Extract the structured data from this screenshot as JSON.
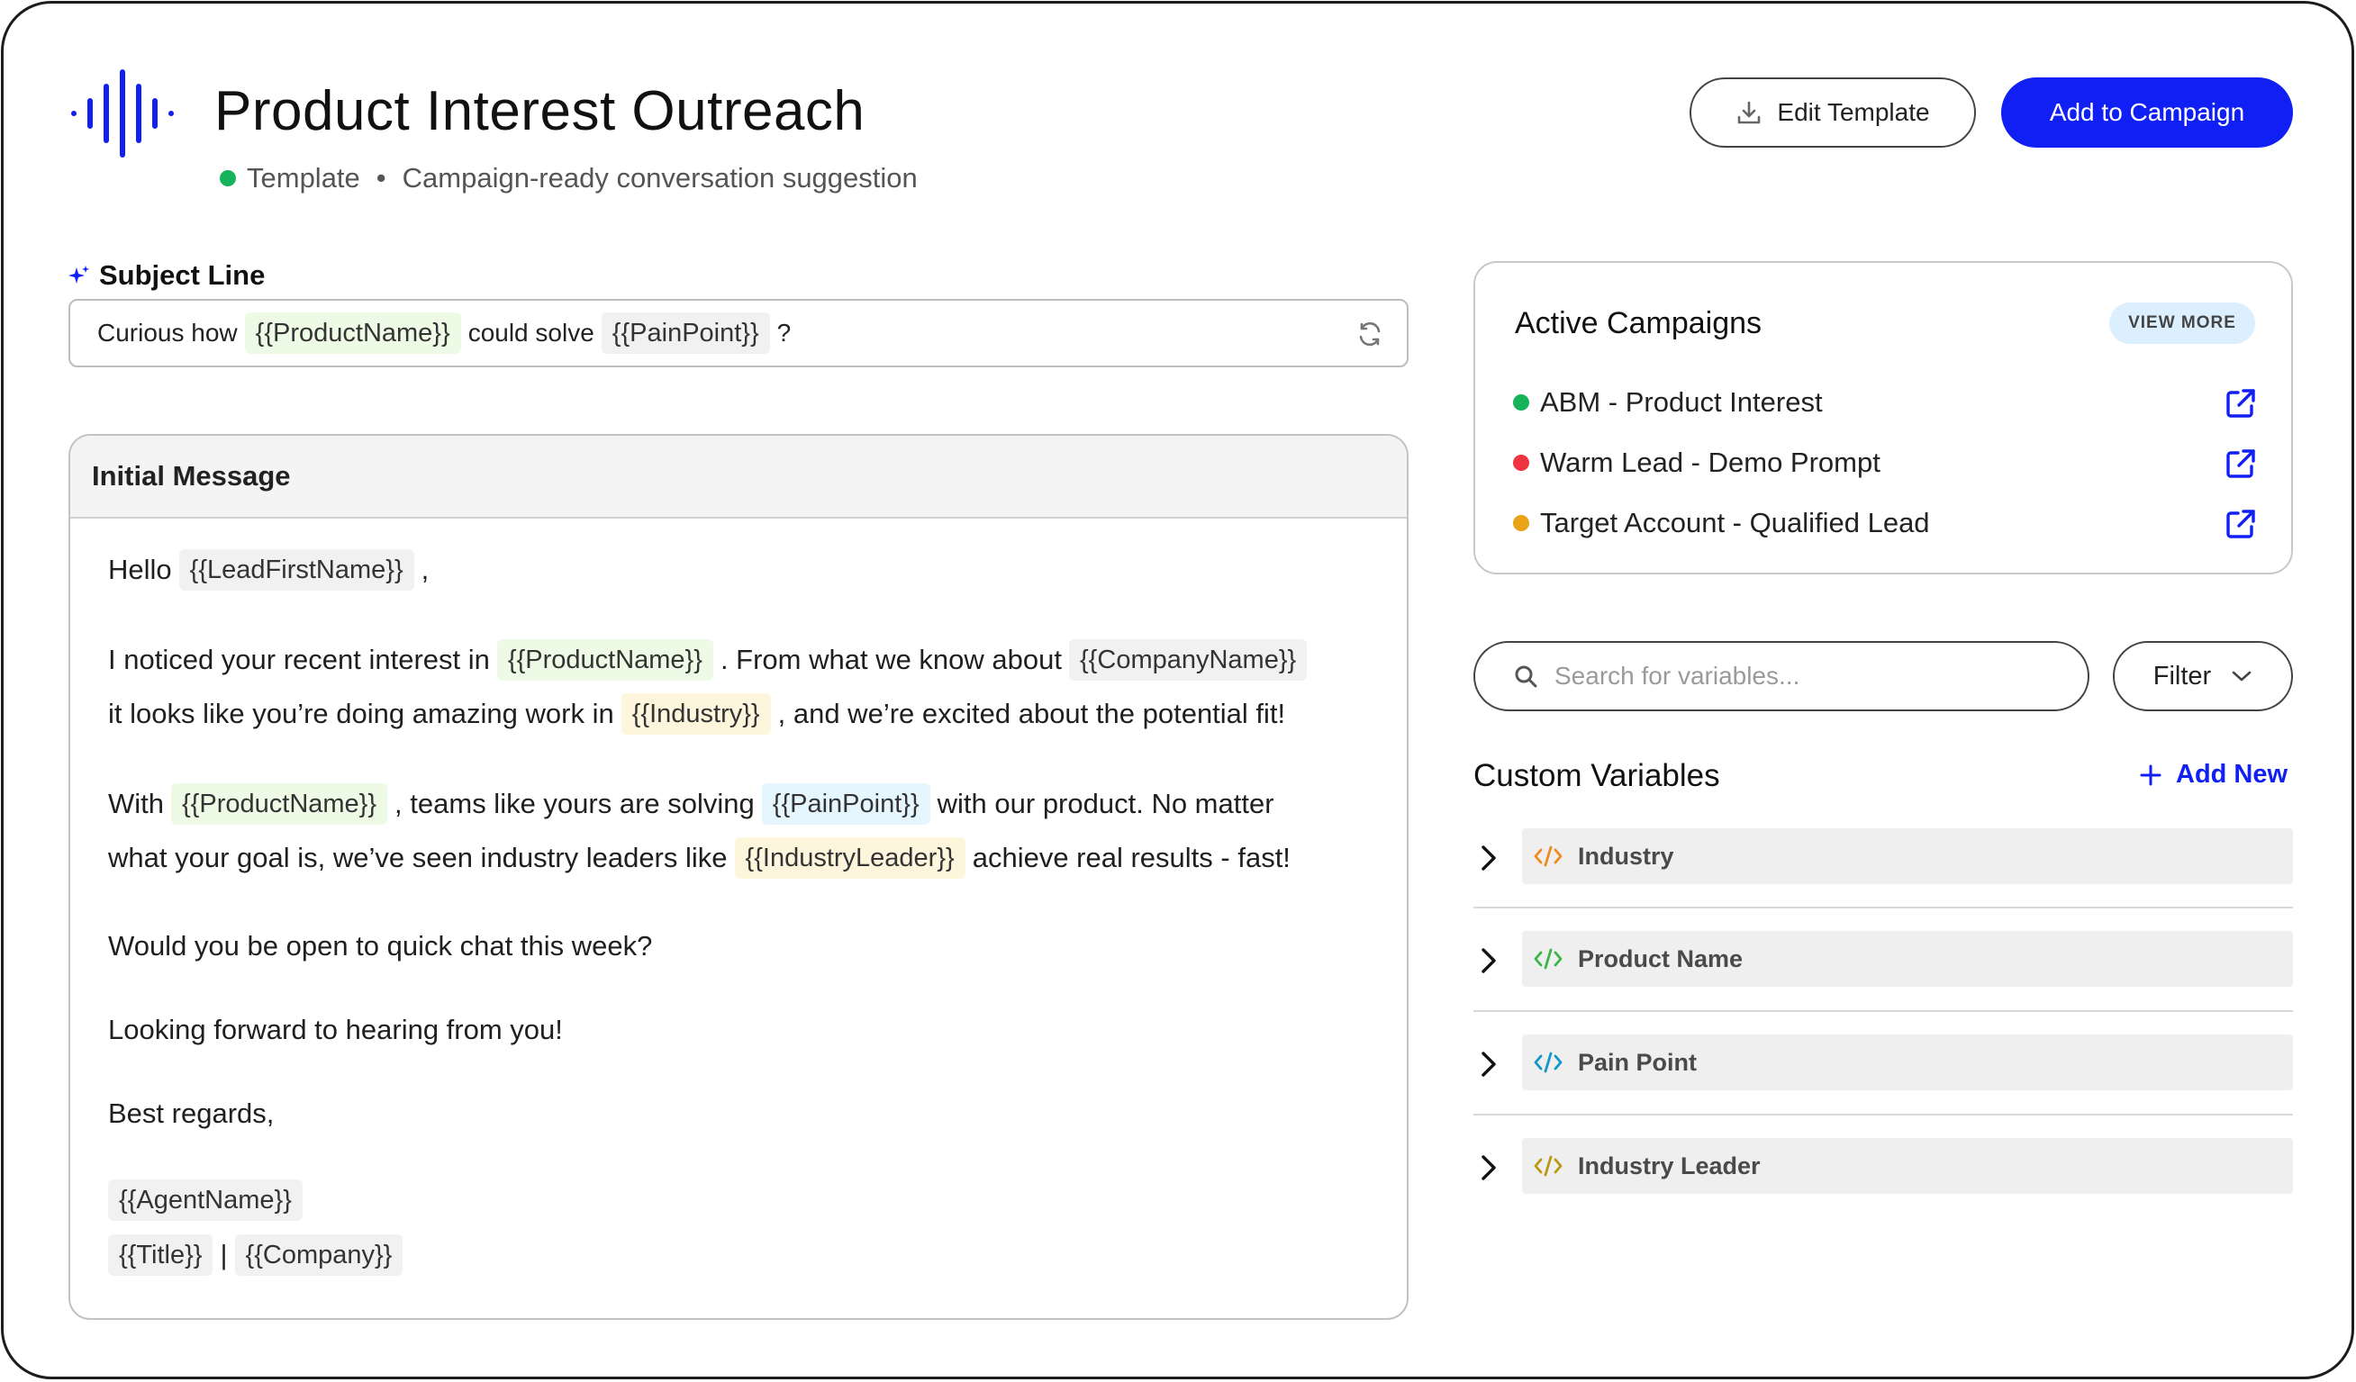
{
  "header": {
    "title": "Product Interest Outreach",
    "status": "Template",
    "separator": "•",
    "description": "Campaign-ready conversation suggestion",
    "edit_label": "Edit Template",
    "add_label": "Add to Campaign",
    "accent": "#1020f5"
  },
  "subject": {
    "label": "Subject Line",
    "parts": [
      "Curious how",
      "{{ProductName}}",
      "could solve",
      "{{PainPoint}}",
      "?"
    ]
  },
  "message": {
    "title": "Initial Message",
    "l1": [
      "Hello",
      "{{LeadFirstName}}",
      ","
    ],
    "l2": [
      "I noticed your recent interest in",
      "{{ProductName}}",
      ". From what we know about",
      "{{CompanyName}}"
    ],
    "l3": [
      "it looks like you’re doing amazing work in",
      "{{Industry}}",
      ", and we’re excited about the potential fit!"
    ],
    "l4": [
      "With",
      "{{ProductName}}",
      ", teams like yours are solving",
      "{{PainPoint}}",
      "with our product. No matter"
    ],
    "l5": [
      "what your goal is, we’ve seen industry leaders like",
      "{{IndustryLeader}}",
      "achieve real results - fast!"
    ],
    "l6": "Would you be open to quick chat this week?",
    "l7": "Looking forward to hearing from you!",
    "l8": "Best regards,",
    "l9": "{{AgentName}}",
    "l10": [
      "{{Title}}",
      "|",
      "{{Company}}"
    ]
  },
  "campaigns": {
    "title": "Active Campaigns",
    "view_more": "VIEW MORE",
    "items": [
      {
        "label": "ABM - Product Interest",
        "color": "#16b35a"
      },
      {
        "label": "Warm Lead - Demo Prompt",
        "color": "#ef3340"
      },
      {
        "label": "Target Account - Qualified Lead",
        "color": "#e8a317"
      }
    ]
  },
  "search": {
    "placeholder": "Search for variables..."
  },
  "filter": {
    "label": "Filter"
  },
  "variables": {
    "title": "Custom Variables",
    "add_new": "Add New",
    "items": [
      {
        "label": "Industry",
        "icon_color": "#f08a1c"
      },
      {
        "label": "Product Name",
        "icon_color": "#3bb54a"
      },
      {
        "label": "Pain Point",
        "icon_color": "#1496c8"
      },
      {
        "label": "Industry Leader",
        "icon_color": "#b89a10"
      }
    ]
  }
}
